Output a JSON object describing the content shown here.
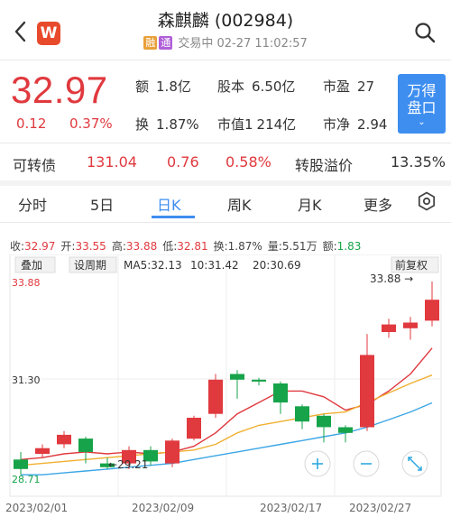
{
  "header": {
    "title": "森麒麟 (002984)",
    "tag1": "融",
    "tag2": "通",
    "status": "交易中 02-27 11:02:57",
    "logo_letter": "W"
  },
  "quote": {
    "price": "32.97",
    "change": "0.12",
    "change_pct": "0.37%",
    "stats": [
      {
        "label": "额",
        "value": "1.8亿"
      },
      {
        "label": "股本",
        "value": "6.50亿"
      },
      {
        "label": "市盈",
        "value": "27"
      },
      {
        "label": "换",
        "value": "1.87%"
      },
      {
        "label": "市值1",
        "value": "214亿"
      },
      {
        "label": "市净",
        "value": "2.94"
      }
    ],
    "wande_button": [
      "万得",
      "盘口"
    ]
  },
  "convertible": {
    "label": "可转债",
    "price": "131.04",
    "change": "0.76",
    "change_pct": "0.58%",
    "premium_label": "转股溢价",
    "premium_value": "13.35%"
  },
  "tabs": [
    "分时",
    "5日",
    "日K",
    "周K",
    "月K",
    "更多"
  ],
  "active_tab": "日K",
  "kline_stats": {
    "close": {
      "label": "收:",
      "value": "32.97"
    },
    "open": {
      "label": "开:",
      "value": "33.55"
    },
    "high": {
      "label": "高:",
      "value": "33.88"
    },
    "low": {
      "label": "低:",
      "value": "32.81"
    },
    "turnover": {
      "label": "换:",
      "value": "1.87%"
    },
    "volume": {
      "label": "量:",
      "value": "5.51万"
    },
    "amount": {
      "label": "额:",
      "value": "1.83"
    }
  },
  "chart_toolbar": {
    "overlay": "叠加",
    "period": "设周期",
    "ma5": "MA5:32.13",
    "ma10": "10:31.42",
    "ma20": "20:30.69",
    "adjust": "前复权"
  },
  "colors": {
    "up": "#e0393e",
    "down": "#16a34a",
    "accent": "#3e8ef0",
    "ma5": "#e0393e",
    "ma10": "#f0b030",
    "ma20": "#3ba6e6"
  },
  "chart_data": {
    "type": "candlestick",
    "ylim": [
      28.71,
      33.88
    ],
    "y_tick_labels": [
      "33.88",
      "31.30",
      "28.71"
    ],
    "x_tick_labels": [
      "2023/02/01",
      "2023/02/09",
      "2023/02/17",
      "2023/02/27"
    ],
    "annotations": [
      {
        "text": "33.88",
        "at": "max"
      },
      {
        "text": "29.21",
        "at": "min"
      }
    ],
    "candles": [
      {
        "open": 29.2,
        "close": 28.95,
        "high": 29.4,
        "low": 28.8
      },
      {
        "open": 29.35,
        "close": 29.5,
        "high": 29.6,
        "low": 29.25
      },
      {
        "open": 29.6,
        "close": 29.85,
        "high": 29.95,
        "low": 29.5
      },
      {
        "open": 29.75,
        "close": 29.4,
        "high": 29.8,
        "low": 29.1
      },
      {
        "open": 29.1,
        "close": 29.0,
        "high": 29.25,
        "low": 28.95
      },
      {
        "open": 29.1,
        "close": 29.45,
        "high": 29.55,
        "low": 28.95
      },
      {
        "open": 29.45,
        "close": 29.15,
        "high": 29.55,
        "low": 29.05
      },
      {
        "open": 29.1,
        "close": 29.7,
        "high": 29.75,
        "low": 29.0
      },
      {
        "open": 29.75,
        "close": 30.3,
        "high": 30.35,
        "low": 29.7
      },
      {
        "open": 30.4,
        "close": 31.3,
        "high": 31.45,
        "low": 30.3
      },
      {
        "open": 31.45,
        "close": 31.3,
        "high": 31.55,
        "low": 30.8
      },
      {
        "open": 31.3,
        "close": 31.25,
        "high": 31.35,
        "low": 31.15
      },
      {
        "open": 31.2,
        "close": 30.7,
        "high": 31.25,
        "low": 30.4
      },
      {
        "open": 30.6,
        "close": 30.2,
        "high": 30.65,
        "low": 30.0
      },
      {
        "open": 30.35,
        "close": 30.05,
        "high": 30.4,
        "low": 29.65
      },
      {
        "open": 30.05,
        "close": 29.9,
        "high": 30.1,
        "low": 29.65
      },
      {
        "open": 30.05,
        "close": 31.95,
        "high": 32.5,
        "low": 29.95
      },
      {
        "open": 32.55,
        "close": 32.75,
        "high": 32.9,
        "low": 32.4
      },
      {
        "open": 32.65,
        "close": 32.8,
        "high": 32.95,
        "low": 32.35
      },
      {
        "open": 32.85,
        "close": 33.4,
        "high": 33.88,
        "low": 32.7
      }
    ],
    "series": [
      {
        "name": "MA5",
        "values": [
          29.2,
          29.25,
          29.35,
          29.4,
          29.35,
          29.4,
          29.35,
          29.4,
          29.55,
          29.9,
          30.4,
          30.7,
          31.0,
          31.0,
          30.85,
          30.5,
          30.65,
          31.0,
          31.45,
          32.13
        ]
      },
      {
        "name": "10",
        "values": [
          29.05,
          29.1,
          29.15,
          29.2,
          29.25,
          29.3,
          29.35,
          29.4,
          29.45,
          29.6,
          29.9,
          30.1,
          30.2,
          30.3,
          30.4,
          30.45,
          30.7,
          30.95,
          31.2,
          31.42
        ]
      },
      {
        "name": "20",
        "values": [
          28.8,
          28.8,
          28.85,
          28.9,
          28.95,
          29.0,
          29.05,
          29.1,
          29.2,
          29.3,
          29.4,
          29.5,
          29.6,
          29.7,
          29.8,
          29.9,
          30.05,
          30.25,
          30.45,
          30.69
        ]
      }
    ]
  }
}
